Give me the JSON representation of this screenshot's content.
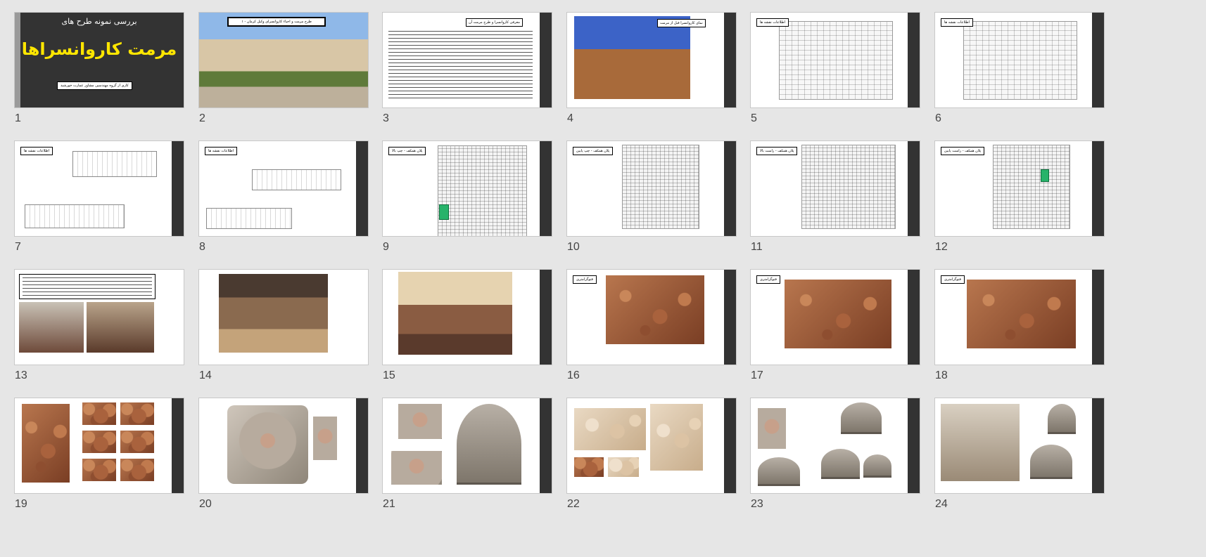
{
  "window": {
    "view": "slide-sorter",
    "background_color": "#e6e6e6"
  },
  "colors": {
    "title_yellow": "#ffe600",
    "dark_slide": "#333333",
    "bar": "#333333",
    "highlight_green": "#27b36a"
  },
  "slides": [
    {
      "number": "1",
      "kind": "title",
      "subtitle": "بررسی نمونه طرح های",
      "title": "مرمت کاروانسراها",
      "footer": "کاری از گروه مهندسین مشاور عمارت خورشید"
    },
    {
      "number": "2",
      "kind": "photo-caption",
      "caption": "۱ - طرح مرمت و احیاء کاروانسرای وکیل کرمان"
    },
    {
      "number": "3",
      "kind": "text",
      "heading": "معرفی کاروانسرا و طرح مرمت آن"
    },
    {
      "number": "4",
      "kind": "photo-label",
      "label": "نمای کاروانسرا قبل از مرمت"
    },
    {
      "number": "5",
      "kind": "plan",
      "label": "اطلاعات نقشه ها"
    },
    {
      "number": "6",
      "kind": "plan",
      "label": "اطلاعات نقشه ها"
    },
    {
      "number": "7",
      "kind": "elevation",
      "label": "اطلاعات نقشه ها"
    },
    {
      "number": "8",
      "kind": "elevation",
      "label": "اطلاعات نقشه ها"
    },
    {
      "number": "9",
      "kind": "plan-green",
      "label": "پلان همکف - چپ بالا"
    },
    {
      "number": "10",
      "kind": "plan",
      "label": "پلان همکف - چپ پایین"
    },
    {
      "number": "11",
      "kind": "plan",
      "label": "پلان همکف - راست بالا"
    },
    {
      "number": "12",
      "kind": "plan-green",
      "label": "پلان همکف - راست پایین"
    },
    {
      "number": "13",
      "kind": "text-photos"
    },
    {
      "number": "14",
      "kind": "photo"
    },
    {
      "number": "15",
      "kind": "photo"
    },
    {
      "number": "16",
      "kind": "texture",
      "label": "فتوگرامتری"
    },
    {
      "number": "17",
      "kind": "texture",
      "label": "فتوگرامتری"
    },
    {
      "number": "18",
      "kind": "texture",
      "label": "فتوگرامتری"
    },
    {
      "number": "19",
      "kind": "texture-grid"
    },
    {
      "number": "20",
      "kind": "dome-plan"
    },
    {
      "number": "21",
      "kind": "dome-3d"
    },
    {
      "number": "22",
      "kind": "pale-texture"
    },
    {
      "number": "23",
      "kind": "domes"
    },
    {
      "number": "24",
      "kind": "facade"
    }
  ]
}
